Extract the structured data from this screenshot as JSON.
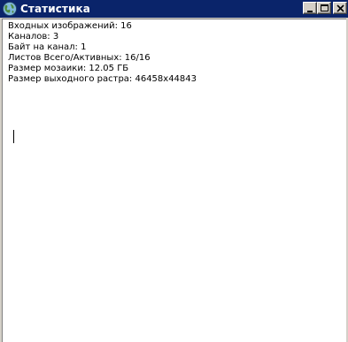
{
  "window": {
    "title": "Статистика",
    "title_bg": "#0a246a",
    "title_fg": "#ffffff",
    "icon": "globe-icon",
    "buttons": {
      "minimize": "minimize-icon",
      "maximize": "maximize-icon",
      "close": "close-icon"
    }
  },
  "stats": [
    "Входных изображений: 16",
    "Каналов: 3",
    "Байт на канал: 1",
    "Листов Всего/Активных: 16/16",
    "Размер мозаики: 12.05 ГБ",
    "Размер выходного растра: 46458x44843"
  ]
}
